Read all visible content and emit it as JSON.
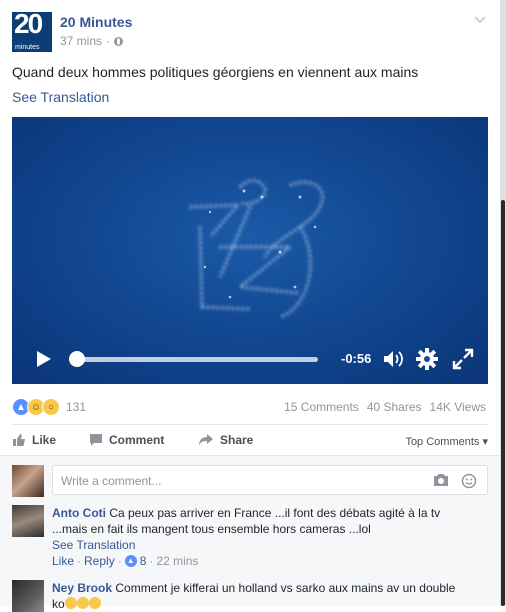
{
  "post": {
    "page_name": "20 Minutes",
    "avatar_text": "20",
    "avatar_subtext": "minutes",
    "time_ago": "37 mins",
    "meta_separator": "·",
    "text": "Quand deux hommes politiques géorgiens en viennent aux mains",
    "see_translation": "See Translation"
  },
  "video": {
    "time_remaining": "-0:56",
    "progress": 0.0
  },
  "reactions": {
    "count": "131",
    "comments": "15 Comments",
    "shares": "40 Shares",
    "views": "14K Views"
  },
  "actions": {
    "like": "Like",
    "comment": "Comment",
    "share": "Share",
    "top_comments": "Top Comments ▾"
  },
  "composer": {
    "placeholder": "Write a comment..."
  },
  "comments": [
    {
      "author": "Anto Coti",
      "text_line1": "Ca peux pas arriver en France ...il font des débats agité à la tv",
      "text_line2": "...mais en fait ils mangent tous ensemble hors cameras ...lol",
      "see_translation": "See Translation",
      "like": "Like",
      "reply": "Reply",
      "sep": "·",
      "likes": "8",
      "time": "22 mins"
    },
    {
      "author": "Ney Brook",
      "text_line1": "Comment je kifferai un holland vs sarko aux mains av un double",
      "text_line2": "ko"
    }
  ],
  "colors": {
    "link": "#365899",
    "video_bg": "#144c97",
    "like_blue": "#5890ff"
  }
}
